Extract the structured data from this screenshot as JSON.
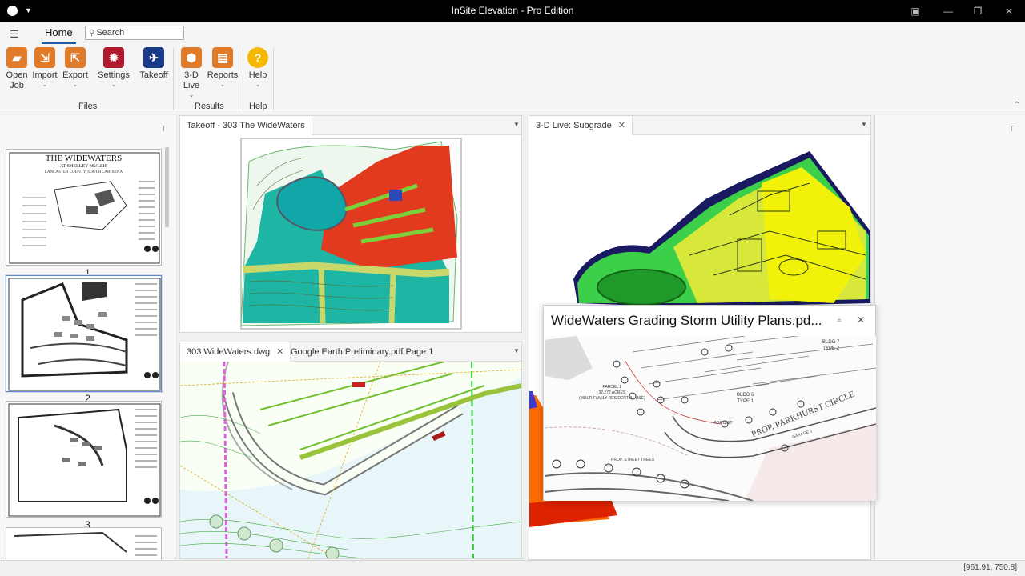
{
  "window": {
    "title": "InSite Elevation - Pro Edition"
  },
  "ribbon": {
    "tab_home": "Home",
    "search_placeholder": "Search",
    "buttons": {
      "open_job": "Open Job",
      "import": "Import",
      "export": "Export",
      "settings": "Settings",
      "takeoff": "Takeoff",
      "live3d": "3-D Live",
      "reports": "Reports",
      "help": "Help"
    },
    "groups": {
      "files": "Files",
      "results": "Results",
      "help": "Help"
    }
  },
  "pages": {
    "thumb1_title": "THE WIDEWATERS",
    "thumb1_sub": "AT SHELLEY MULLIS",
    "thumb1_loc": "LANCASTER COUNTY, SOUTH CAROLINA",
    "labels": [
      "1",
      "2",
      "3"
    ]
  },
  "panels": {
    "takeoff_tab": "Takeoff - 303 The WideWaters",
    "live_tab": "3-D Live: Subgrade",
    "dwg_tab": "303 WideWaters.dwg",
    "pdf_tab": "Google Earth Preliminary.pdf Page 1"
  },
  "floating": {
    "title": "WideWaters Grading Storm Utility Plans.pd...",
    "plan_labels": {
      "parcel": "PARCEL 1",
      "acres": "32.272 ACRES",
      "use": "(MULTI-FAMILY RESIDENTIAL USE)",
      "bldg6": "BLDG 6",
      "type1": "TYPE 1",
      "bldg7": "BLDG 7",
      "type2": "TYPE 2",
      "ada": "ADA UNIT",
      "street": "PROP. PARKHURST CIRCLE",
      "garage": "GARAGE 6",
      "trees": "PROP. STREET TREES"
    }
  },
  "status": {
    "coordinates": "[961.91, 750.8]"
  }
}
